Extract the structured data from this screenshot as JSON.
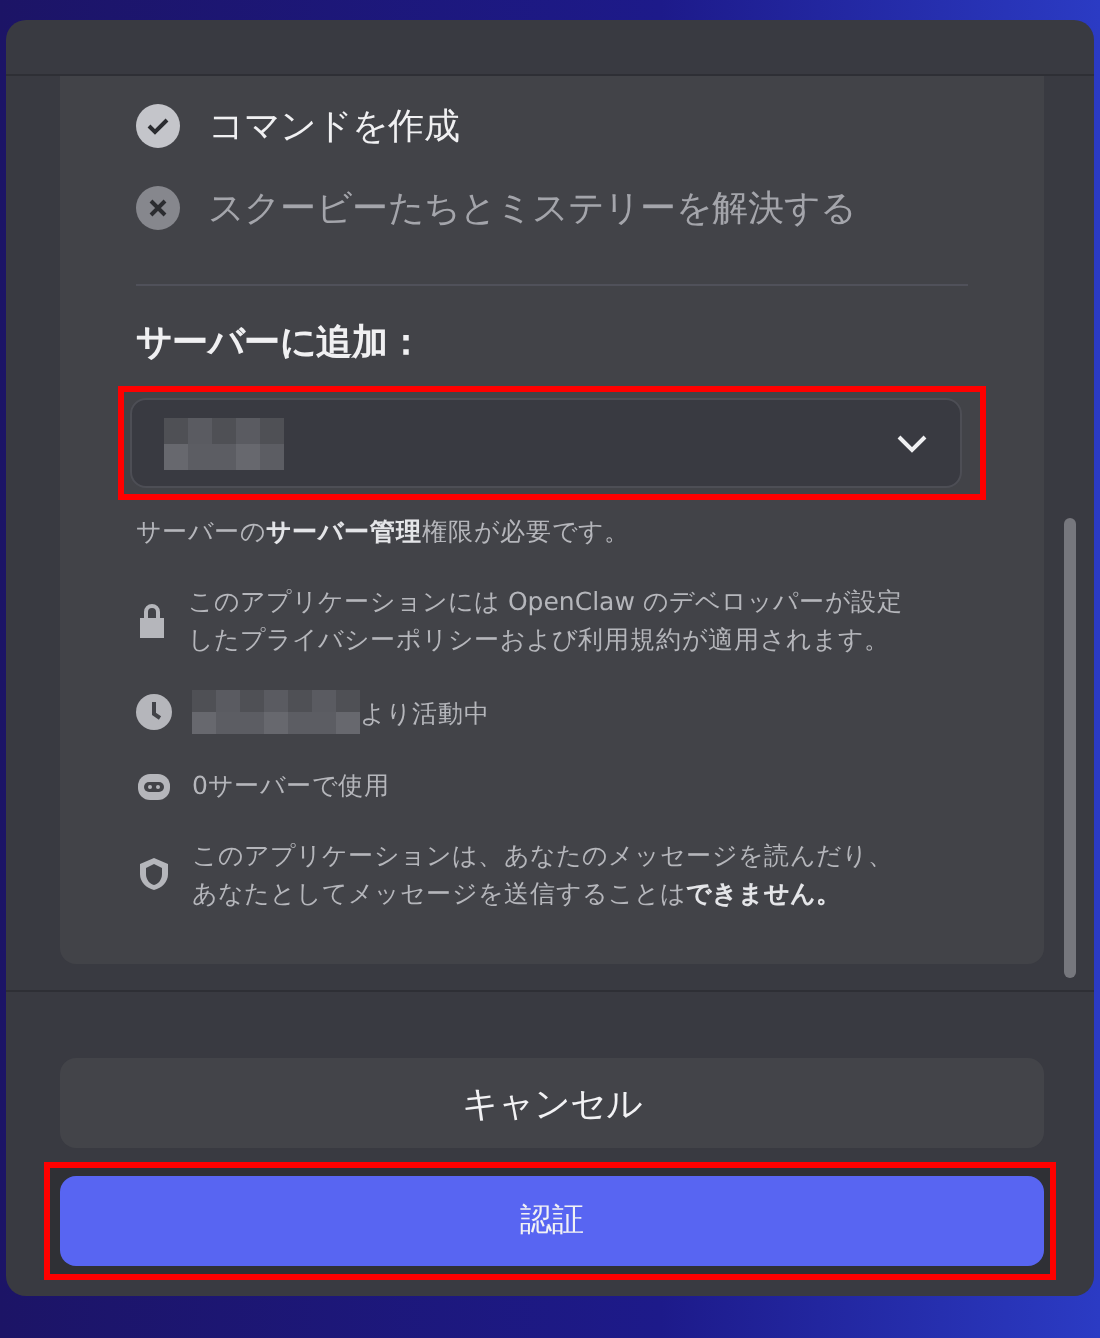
{
  "permissions": [
    {
      "label": "コマンドを作成",
      "granted": true
    },
    {
      "label": "スクービーたちとミステリーを解決する",
      "granted": false
    }
  ],
  "add_to_server": {
    "label": "サーバーに追加：",
    "value_redacted": true,
    "highlighted": true,
    "hint": "サーバーの**サーバー管理**権限が必要です。"
  },
  "info": [
    {
      "kind": "lock",
      "text": "このアプリケーションには OpenClaw のデベロッパーが設定したプライバシーポリシーおよび利用規約が適用されます。",
      "redacted": false
    },
    {
      "kind": "clock",
      "text": "より活動中",
      "redacted": true
    },
    {
      "kind": "bot",
      "text": "0サーバーで使用",
      "redacted": false
    },
    {
      "kind": "shield",
      "text": "このアプリケーションは、あなたのメッセージを読んだり、あなたとしてメッセージを送信することは**できません。**",
      "redacted": false
    }
  ],
  "buttons": [
    {
      "label": "キャンセル",
      "kind": "secondary",
      "highlighted": false
    },
    {
      "label": "認証",
      "kind": "primary",
      "highlighted": true
    }
  ]
}
